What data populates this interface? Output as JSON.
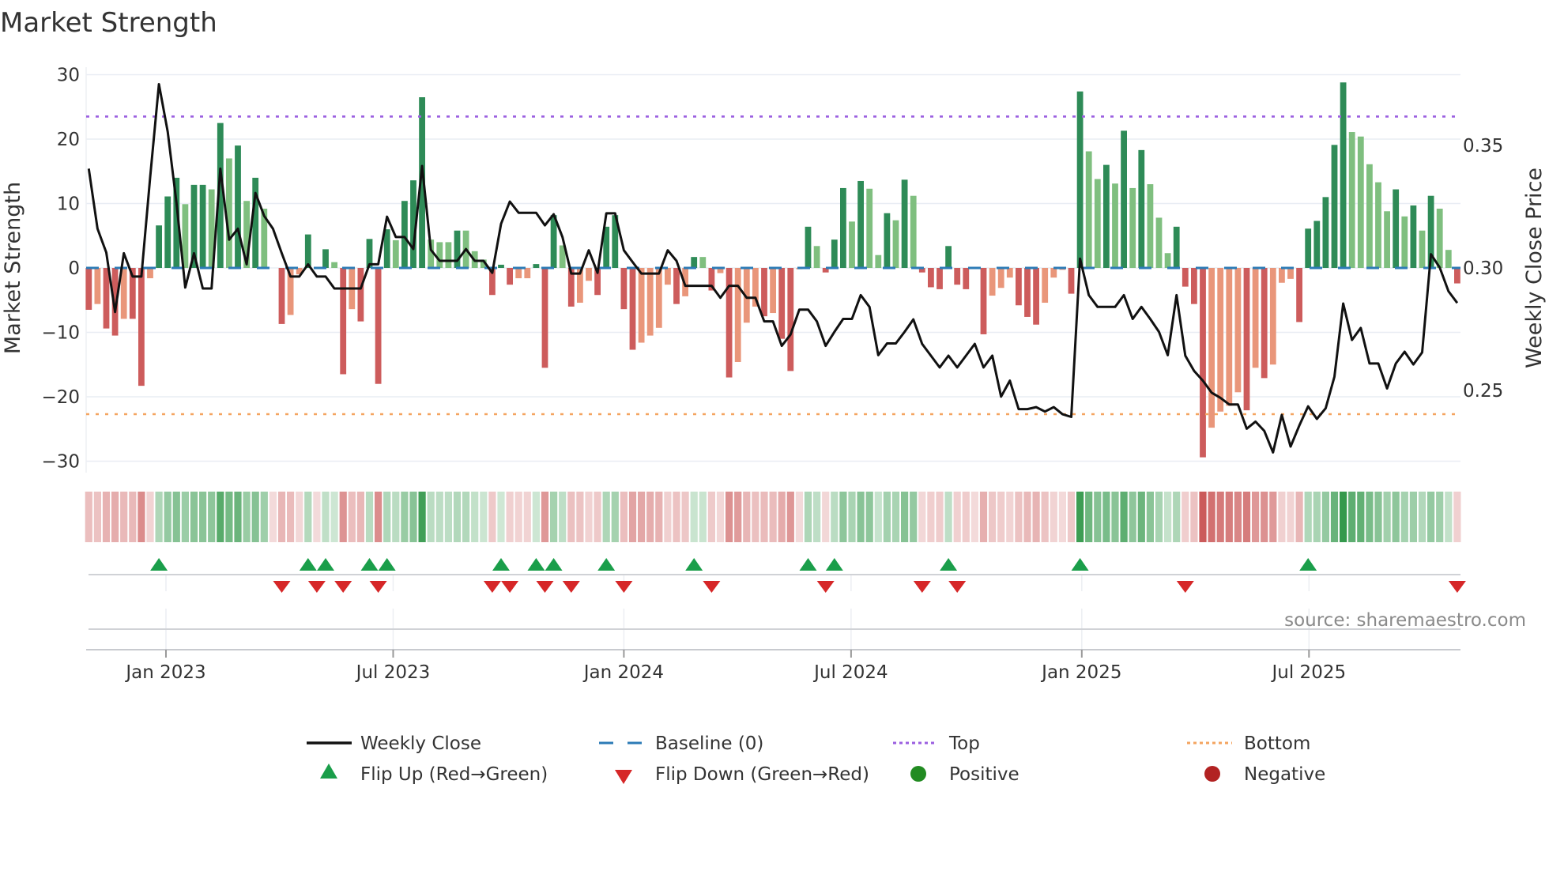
{
  "chart_data": {
    "type": "bar",
    "title": "Market Strength",
    "ylabel": "Market Strength",
    "y2label": "Weekly Close Price",
    "ylim": [
      -32,
      32
    ],
    "y_ticks": [
      30,
      20,
      10,
      0,
      -10,
      -20,
      -30
    ],
    "y_tick_labels": [
      "30",
      "20",
      "10",
      "0",
      "−10",
      "−20",
      "−30"
    ],
    "y2_ticks": [
      0.35,
      0.3,
      0.25
    ],
    "y2_tick_labels": [
      "0.35",
      "0.30",
      "0.25"
    ],
    "x_unit": "week index",
    "x_ticks": [
      8.8,
      34.7,
      61.0,
      86.9,
      113.2,
      139.1
    ],
    "x_tick_labels": [
      "Jan 2023",
      "Jul 2023",
      "Jan 2024",
      "Jul 2024",
      "Jan 2025",
      "Jul 2025"
    ],
    "top_level": 23.5,
    "bottom_level": -22.7,
    "baseline": 0,
    "strength": [
      -6.5,
      -5.6,
      -9.4,
      -10.5,
      -7.9,
      -7.9,
      -18.3,
      -1.6,
      6.6,
      11.1,
      14,
      9.9,
      12.9,
      12.9,
      12.2,
      22.5,
      17,
      19,
      10.4,
      14,
      9.2,
      0,
      -8.7,
      -7.3,
      -1,
      5.2,
      0,
      2.9,
      0.9,
      -16.5,
      -6.4,
      -8.3,
      4.5,
      -18,
      6,
      4.3,
      10.4,
      13.6,
      26.5,
      4.4,
      4,
      4,
      5.8,
      5.8,
      2.6,
      1.3,
      -4.2,
      0.5,
      -2.6,
      -1.6,
      -1.6,
      0.6,
      -15.5,
      8.2,
      3.5,
      -6,
      -5.4,
      -2,
      -4.2,
      6.4,
      8.2,
      -6.4,
      -12.7,
      -11.6,
      -10.5,
      -9.3,
      -2.6,
      -5.6,
      -4.4,
      1.7,
      1.7,
      -3.5,
      -0.8,
      -17,
      -14.6,
      -8.5,
      -6,
      -7.5,
      -7,
      -11,
      -16,
      -0.2,
      6.4,
      3.4,
      -0.7,
      4.4,
      12.4,
      7.2,
      13.5,
      12.3,
      2,
      8.5,
      7.4,
      13.7,
      11.2,
      -0.7,
      -3,
      -3.3,
      3.4,
      -2.6,
      -3.3,
      0,
      -10.3,
      -4.3,
      -3.1,
      -1.5,
      -5.8,
      -7.6,
      -8.8,
      -5.4,
      -1.5,
      -0.3,
      -4,
      27.4,
      18.1,
      13.8,
      16,
      13.1,
      21.3,
      12.4,
      18.3,
      13,
      7.8,
      2.3,
      6.4,
      -2.9,
      -5.6,
      -29.4,
      -24.8,
      -22.3,
      -21.4,
      -19.3,
      -22.1,
      -15.5,
      -17.1,
      -15,
      -2.3,
      -1.7,
      -8.4,
      6.1,
      7.3,
      11,
      19.1,
      28.8,
      21.1,
      20.4,
      16.1,
      13.3,
      8.8,
      12.2,
      8,
      9.7,
      5.8,
      11.2,
      9.2,
      2.8,
      -2.4
    ],
    "bar_shade": "rsrrsrrsdddlddldldldl-rssd-dlrsrdrdldddllldlllrdrssdrdlrssrddrrssssrsdlrsrsssrsrrsdlrddldlldldlrrrdrr-rsssrrrsssrdlldldldllldrrrssssrsrsssrdddddllllldldldllr",
    "weekly_close": [
      0.3405,
      0.316,
      0.3063,
      0.282,
      0.306,
      0.2965,
      0.2965,
      0.337,
      0.375,
      0.3556,
      0.3266,
      0.292,
      0.306,
      0.2916,
      0.2916,
      0.3405,
      0.3115,
      0.316,
      0.3015,
      0.3306,
      0.3212,
      0.316,
      0.306,
      0.2965,
      0.2965,
      0.3015,
      0.2965,
      0.2965,
      0.2916,
      0.2916,
      0.2916,
      0.2916,
      0.3015,
      0.3015,
      0.3209,
      0.3126,
      0.3126,
      0.3077,
      0.3416,
      0.3074,
      0.3029,
      0.3029,
      0.3029,
      0.3077,
      0.3029,
      0.3029,
      0.298,
      0.318,
      0.3271,
      0.3225,
      0.3225,
      0.3225,
      0.3174,
      0.3219,
      0.3126,
      0.2977,
      0.2977,
      0.3072,
      0.298,
      0.3223,
      0.3223,
      0.3072,
      0.3024,
      0.2977,
      0.2977,
      0.2977,
      0.3072,
      0.3029,
      0.2927,
      0.2927,
      0.2927,
      0.2927,
      0.2878,
      0.2927,
      0.2927,
      0.2878,
      0.2878,
      0.2782,
      0.2782,
      0.2682,
      0.2728,
      0.283,
      0.283,
      0.2782,
      0.2682,
      0.2739,
      0.2792,
      0.2792,
      0.2889,
      0.2841,
      0.2644,
      0.2692,
      0.2692,
      0.2739,
      0.279,
      0.269,
      0.2642,
      0.2594,
      0.2642,
      0.2594,
      0.2642,
      0.269,
      0.2594,
      0.2642,
      0.2475,
      0.254,
      0.2424,
      0.2424,
      0.2432,
      0.2414,
      0.2432,
      0.2403,
      0.2392,
      0.3038,
      0.2889,
      0.2841,
      0.2841,
      0.2841,
      0.2889,
      0.2792,
      0.2841,
      0.2792,
      0.2739,
      0.2644,
      0.2889,
      0.2642,
      0.258,
      0.254,
      0.2491,
      0.247,
      0.2443,
      0.2443,
      0.2344,
      0.2373,
      0.2335,
      0.2247,
      0.24,
      0.2271,
      0.2357,
      0.2435,
      0.2384,
      0.2427,
      0.2556,
      0.2855,
      0.2706,
      0.2755,
      0.261,
      0.261,
      0.2508,
      0.261,
      0.2658,
      0.2606,
      0.2655,
      0.3056,
      0.3002,
      0.2905,
      0.2857
    ],
    "flip_up_weeks": [
      8,
      25,
      27,
      32,
      34,
      47,
      51,
      53,
      59,
      69,
      82,
      85,
      98,
      113,
      139
    ],
    "flip_down_weeks": [
      22,
      26,
      29,
      33,
      46,
      48,
      52,
      55,
      61,
      71,
      84,
      95,
      99,
      125,
      156
    ],
    "legend": {
      "weekly_close": "Weekly Close",
      "baseline": "Baseline (0)",
      "top": "Top",
      "bottom": "Bottom",
      "flip_up": "Flip Up (Red→Green)",
      "flip_down": "Flip Down (Green→Red)",
      "positive": "Positive",
      "negative": "Negative"
    },
    "source": "source: sharemaestro.com",
    "colors": {
      "strong_positive": "#2e8b57",
      "weak_positive": "#7fbf7f",
      "strong_negative": "#cd5c5c",
      "weak_negative": "#e9967a",
      "line": "#111111",
      "baseline": "#2c7bb6",
      "top": "#9b5fe0",
      "bottom": "#f4a460",
      "flip_up": "#1a9e4a",
      "flip_down": "#d62728",
      "positive": "#228b22",
      "negative": "#b22222"
    }
  }
}
